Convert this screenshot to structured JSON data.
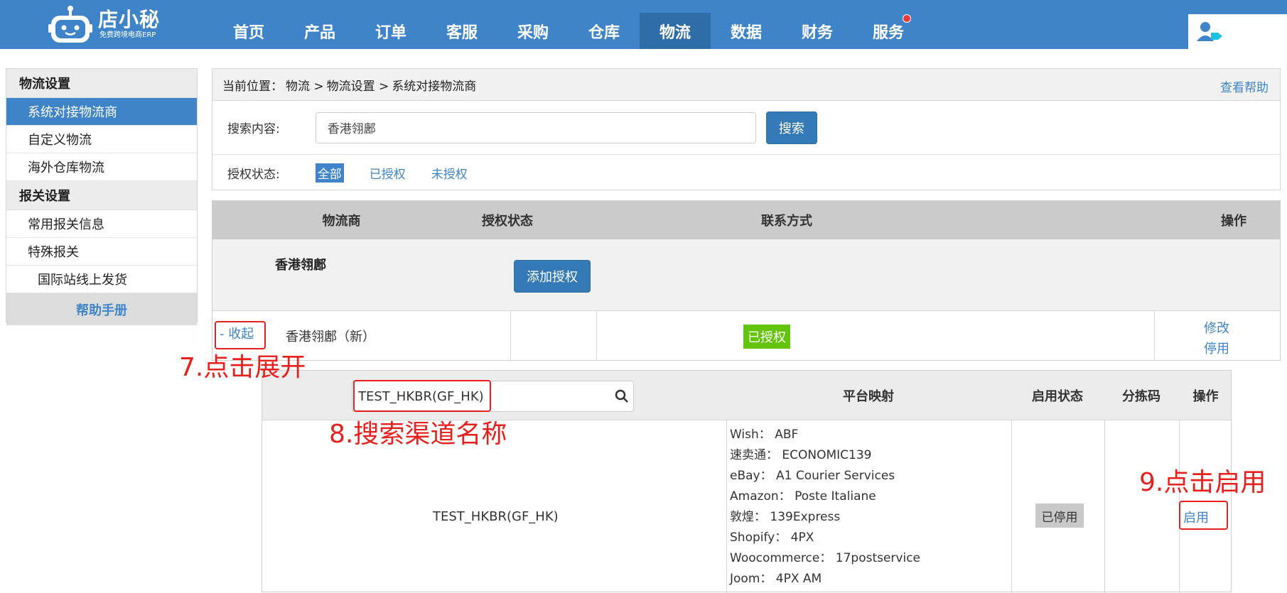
{
  "logo": {
    "name": "店小秘",
    "tagline": "免费跨境电商ERP"
  },
  "nav": {
    "items": [
      {
        "label": "首页"
      },
      {
        "label": "产品"
      },
      {
        "label": "订单"
      },
      {
        "label": "客服"
      },
      {
        "label": "采购"
      },
      {
        "label": "仓库"
      },
      {
        "label": "物流",
        "active": true
      },
      {
        "label": "数据"
      },
      {
        "label": "财务"
      },
      {
        "label": "服务",
        "has_dot": true
      }
    ]
  },
  "sidebar": {
    "section1": "物流设置",
    "items1": [
      "系统对接物流商",
      "自定义物流",
      "海外仓库物流"
    ],
    "section2": "报关设置",
    "items2": [
      "常用报关信息",
      "特殊报关",
      "国际站线上发货"
    ],
    "help": "帮助手册"
  },
  "breadcrumb": {
    "prefix": "当前位置：",
    "path": [
      "物流 >",
      "物流设置 >",
      "系统对接物流商"
    ],
    "help_link": "查看帮助"
  },
  "search": {
    "label": "搜索内容:",
    "value": "香港翎鄌",
    "button": "搜索"
  },
  "auth_filter": {
    "label": "授权状态:",
    "options": [
      "全部",
      "已授权",
      "未授权"
    ],
    "selected": "全部"
  },
  "table": {
    "headers": [
      "物流商",
      "授权状态",
      "联系方式",
      "操作"
    ],
    "provider": {
      "name": "香港翎鄌",
      "add_auth": "添加授权"
    },
    "channel": {
      "toggle": "- 收起",
      "name": "香港翎鄌（新）",
      "status": "已授权",
      "actions": [
        "修改",
        "停用"
      ]
    }
  },
  "sub_table": {
    "search_value": "TEST_HKBR(GF_HK)",
    "headers": [
      "平台映射",
      "启用状态",
      "分拣码",
      "操作"
    ],
    "row": {
      "code": "TEST_HKBR(GF_HK)",
      "mappings": [
        "Wish： ABF",
        "速卖通： ECONOMIC139",
        "eBay： A1 Courier Services",
        "Amazon： Poste Italiane",
        "敦煌： 139Express",
        "Shopify： 4PX",
        "Woocommerce： 17postservice",
        "Joom： 4PX AM"
      ],
      "status": "已停用",
      "action": "启用"
    }
  },
  "annotations": {
    "step7": "7.点击展开",
    "step8": "8.搜索渠道名称",
    "step9": "9.点击启用"
  },
  "colors": {
    "brand": "#3f84c8",
    "active_nav": "#2f6da9",
    "annotation": "#e8201d",
    "authorized": "#64c40a"
  }
}
